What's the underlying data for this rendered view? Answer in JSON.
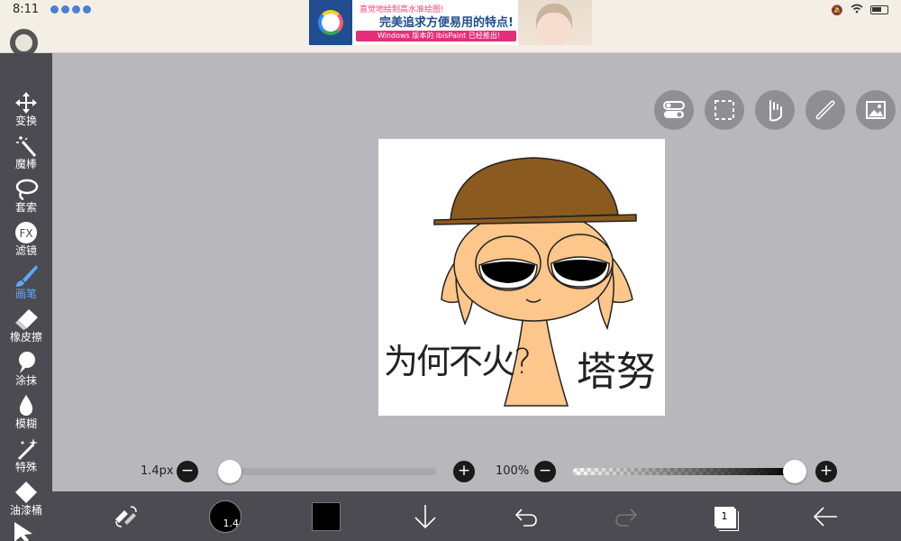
{
  "status_bar": {
    "time": "8:11"
  },
  "ad": {
    "line1": "直觉地绘制高水准绘图!",
    "line2": "完美追求方便易用的特点!",
    "line3": "Windows 版本的 ibisPaint 已经推出!"
  },
  "tools": [
    {
      "label": "变换",
      "icon": "move-icon"
    },
    {
      "label": "魔棒",
      "icon": "magic-wand-icon"
    },
    {
      "label": "套索",
      "icon": "lasso-icon"
    },
    {
      "label": "滤镜",
      "icon": "fx-icon"
    },
    {
      "label": "画笔",
      "icon": "brush-icon"
    },
    {
      "label": "橡皮擦",
      "icon": "eraser-icon"
    },
    {
      "label": "涂抹",
      "icon": "smudge-icon"
    },
    {
      "label": "模糊",
      "icon": "blur-drop-icon"
    },
    {
      "label": "特殊",
      "icon": "sparkle-icon"
    },
    {
      "label": "油漆桶",
      "icon": "bucket-icon"
    }
  ],
  "active_tool": "画笔",
  "brush": {
    "size_label": "1.4px",
    "size_badge": "1.4",
    "size_fraction": 0.02,
    "opacity_label": "100%",
    "opacity_fraction": 1.0,
    "color": "#000000"
  },
  "drawing": {
    "text_left": "为何不火?",
    "text_right": "塔努"
  },
  "layers": {
    "count": "1"
  },
  "colors": {
    "toolbar_bg": "#4c4b51",
    "workspace_bg": "#b8b7bc",
    "active_tool": "#5aa9ff",
    "skin": "#fdc68a",
    "hat": "#8b5a1f"
  }
}
